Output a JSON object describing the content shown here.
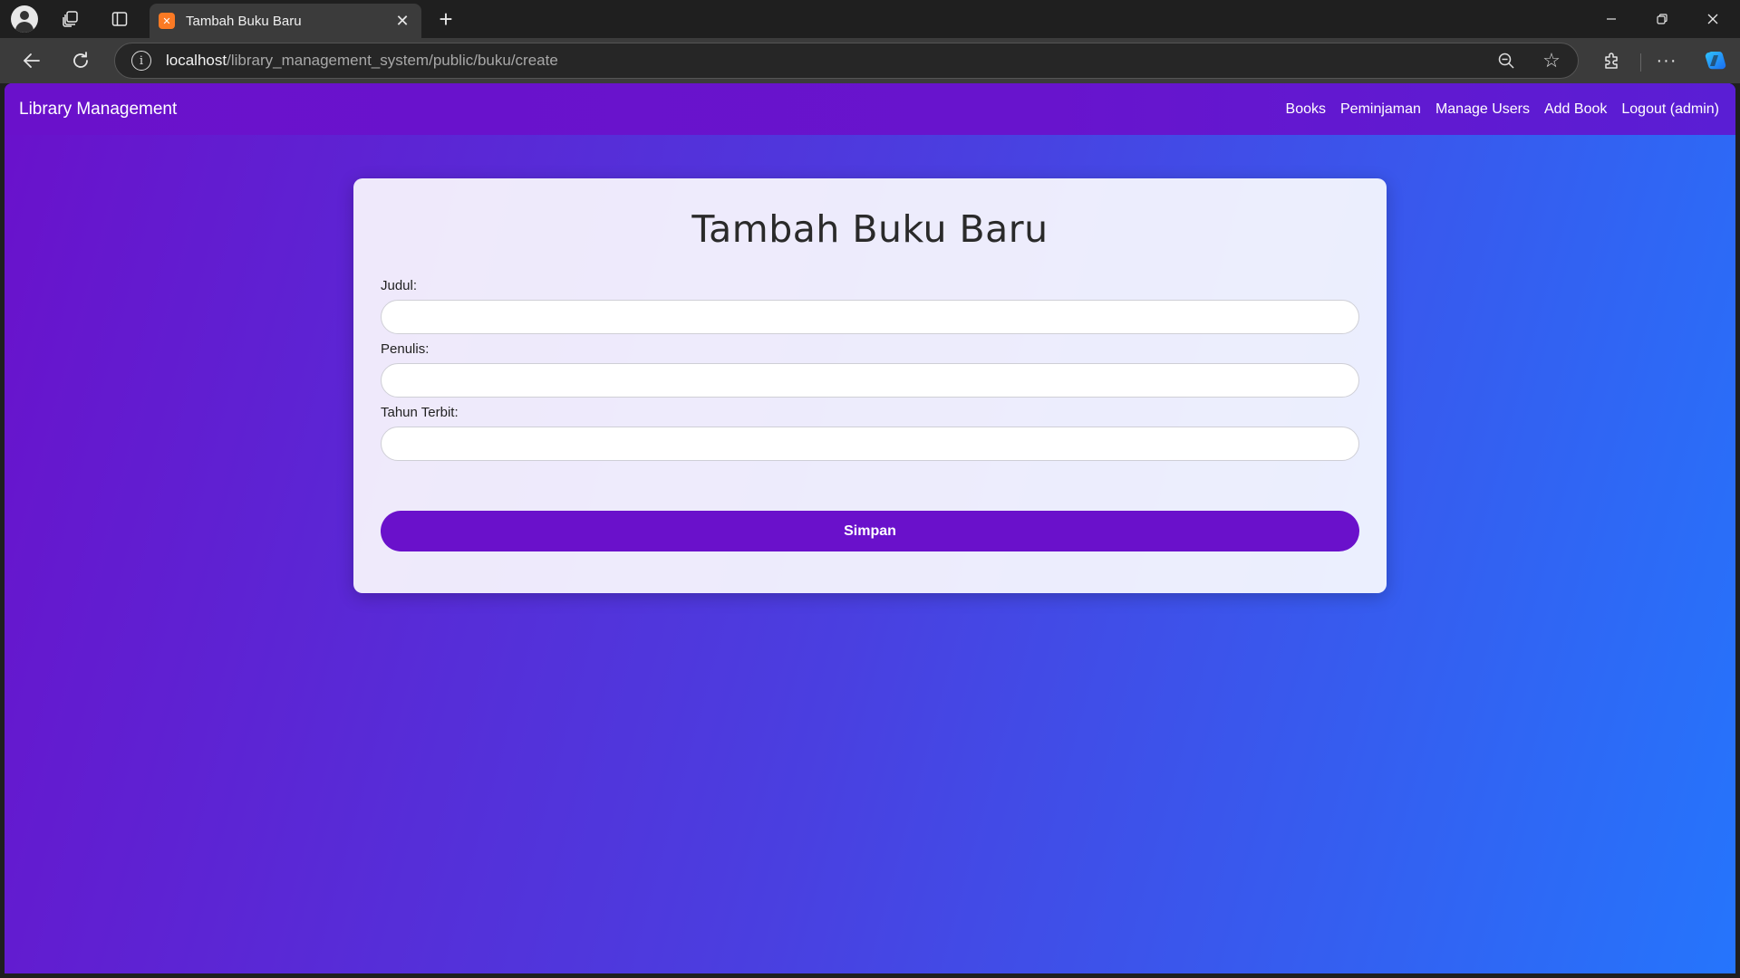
{
  "browser": {
    "tab": {
      "title": "Tambah Buku Baru",
      "favicon": "xampp-icon"
    },
    "url": {
      "host": "localhost",
      "path": "/library_management_system/public/buku/create"
    },
    "icons": {
      "profile": "profile-icon",
      "workspaces": "workspaces-icon",
      "tab_actions": "tab-actions-icon",
      "close_tab": "close-icon",
      "new_tab": "plus-icon",
      "minimize": "minimize-icon",
      "maximize": "restore-icon",
      "close_window": "close-icon",
      "back": "back-arrow-icon",
      "reload": "reload-icon",
      "site_info": "info-icon",
      "zoom": "zoom-out-icon",
      "favorite": "star-icon",
      "extensions": "puzzle-icon",
      "more": "more-icon",
      "copilot": "copilot-icon"
    },
    "glyphs": {
      "close": "✕",
      "new_tab": "+",
      "info": "i",
      "star": "☆",
      "more": "···",
      "favicon": "✕"
    }
  },
  "navbar": {
    "brand": "Library Management",
    "links": [
      "Books",
      "Peminjaman",
      "Manage Users",
      "Add Book",
      "Logout (admin)"
    ]
  },
  "form": {
    "title": "Tambah Buku Baru",
    "fields": [
      {
        "label": "Judul:",
        "value": ""
      },
      {
        "label": "Penulis:",
        "value": ""
      },
      {
        "label": "Tahun Terbit:",
        "value": ""
      }
    ],
    "submit_label": "Simpan"
  },
  "colors": {
    "gradient_start": "#6a11cb",
    "gradient_end": "#2575fc",
    "button": "#6a11cb",
    "favicon": "#fb7a24"
  }
}
